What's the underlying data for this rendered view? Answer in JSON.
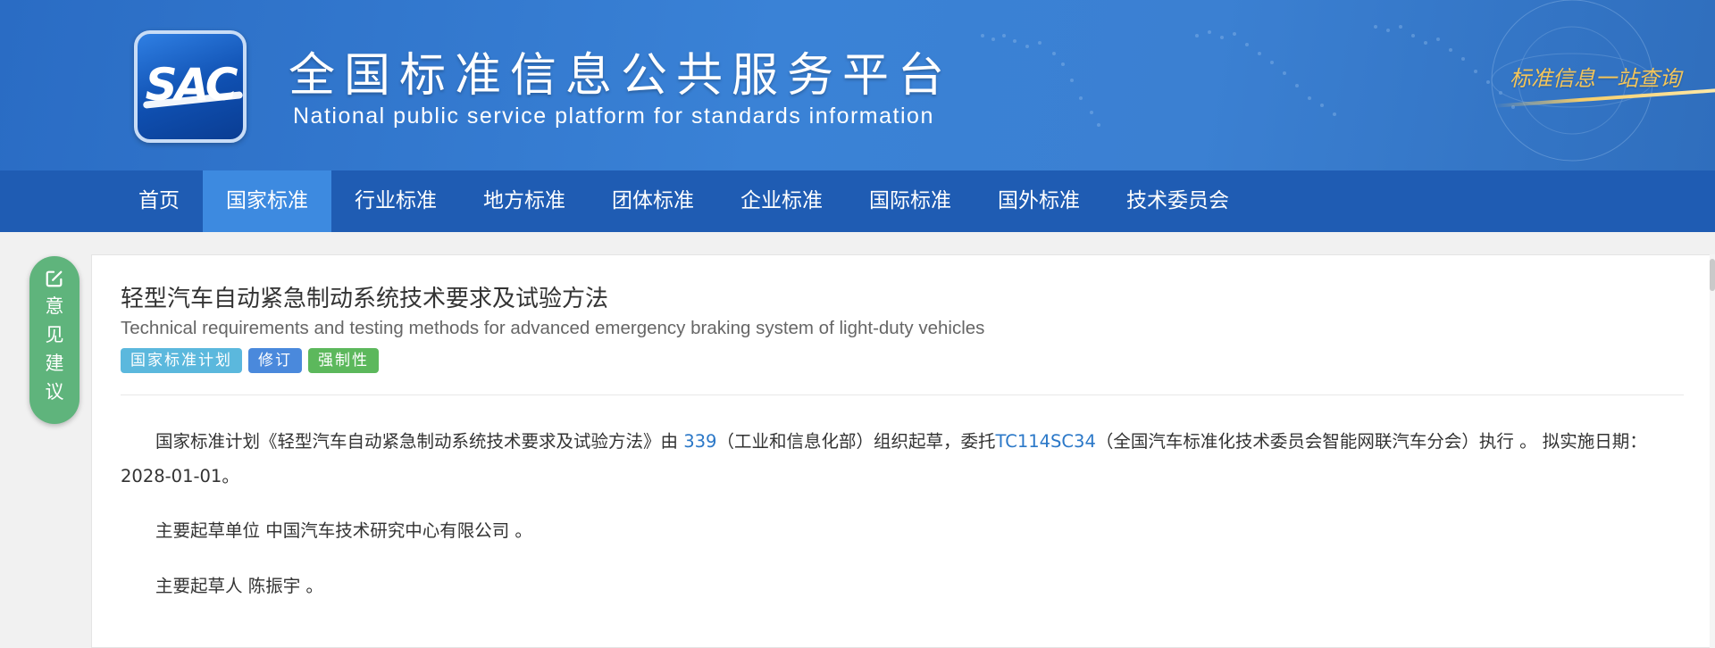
{
  "header": {
    "logo_text": "SAC",
    "title_cn": "全国标准信息公共服务平台",
    "title_en": "National public service platform  for standards information",
    "slogan": "标准信息一站查询"
  },
  "nav": {
    "items": [
      {
        "label": "首页",
        "active": false
      },
      {
        "label": "国家标准",
        "active": true
      },
      {
        "label": "行业标准",
        "active": false
      },
      {
        "label": "地方标准",
        "active": false
      },
      {
        "label": "团体标准",
        "active": false
      },
      {
        "label": "企业标准",
        "active": false
      },
      {
        "label": "国际标准",
        "active": false
      },
      {
        "label": "国外标准",
        "active": false
      },
      {
        "label": "技术委员会",
        "active": false
      }
    ]
  },
  "feedback": {
    "chars": [
      "意",
      "见",
      "建",
      "议"
    ]
  },
  "document": {
    "title_cn": "轻型汽车自动紧急制动系统技术要求及试验方法",
    "title_en": "Technical requirements and testing methods for advanced emergency braking system of light-duty vehicles",
    "tags": [
      {
        "label": "国家标准计划",
        "color": "#5bc0de"
      },
      {
        "label": "修订",
        "color": "#4a89dc"
      },
      {
        "label": "强制性",
        "color": "#5cb85c"
      }
    ],
    "intro": {
      "prefix": "国家标准计划《轻型汽车自动紧急制动系统技术要求及试验方法》由 ",
      "org_code": "339",
      "org_name": "（工业和信息化部）组织起草，委托",
      "tc_code": "TC114SC34",
      "tc_name": "（全国汽车标准化技术委员会智能网联汽车分会）执行 。 拟实施日期：2028-01-01。"
    },
    "drafting_unit": "主要起草单位 中国汽车技术研究中心有限公司 。",
    "drafters": "主要起草人 陈振宇 。"
  },
  "colors": {
    "banner": "#3a82d6",
    "nav": "#1f5cb3",
    "nav_active": "#3d8ae0",
    "feedback": "#5fb47c",
    "link": "#2b78c8"
  }
}
